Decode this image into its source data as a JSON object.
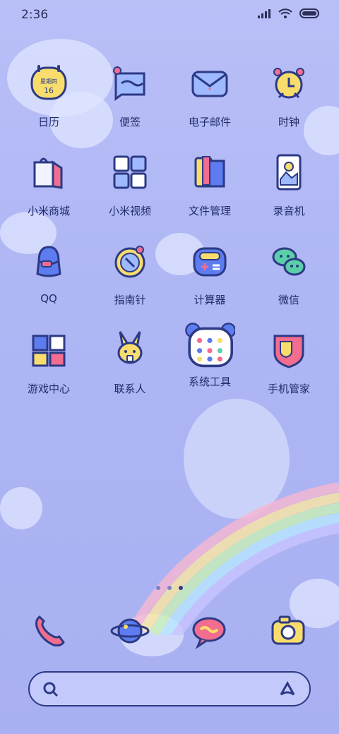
{
  "status_bar": {
    "time": "2:36"
  },
  "apps": [
    {
      "label": "日历",
      "icon": "calendar-icon",
      "date_day": "星期四",
      "date_num": "16"
    },
    {
      "label": "便签",
      "icon": "notes-icon"
    },
    {
      "label": "电子邮件",
      "icon": "email-icon"
    },
    {
      "label": "时钟",
      "icon": "clock-icon"
    },
    {
      "label": "小米商城",
      "icon": "store-icon"
    },
    {
      "label": "小米视频",
      "icon": "video-icon"
    },
    {
      "label": "文件管理",
      "icon": "file-manager-icon"
    },
    {
      "label": "录音机",
      "icon": "recorder-icon"
    },
    {
      "label": "QQ",
      "icon": "qq-icon"
    },
    {
      "label": "指南针",
      "icon": "compass-icon"
    },
    {
      "label": "计算器",
      "icon": "calculator-icon"
    },
    {
      "label": "微信",
      "icon": "wechat-icon"
    },
    {
      "label": "游戏中心",
      "icon": "game-center-icon"
    },
    {
      "label": "联系人",
      "icon": "contacts-icon"
    },
    {
      "label": "系统工具",
      "icon": "system-tools-icon"
    },
    {
      "label": "手机管家",
      "icon": "security-icon"
    }
  ],
  "dock": [
    {
      "icon": "phone-icon"
    },
    {
      "icon": "browser-icon"
    },
    {
      "icon": "messages-icon"
    },
    {
      "icon": "camera-icon"
    }
  ],
  "page_indicator": {
    "count": 3,
    "active_index": 2
  },
  "colors": {
    "outline": "#2c3a85",
    "pink": "#f26d8f",
    "yellow": "#f8dd6c",
    "blue": "#5c7cf0"
  }
}
